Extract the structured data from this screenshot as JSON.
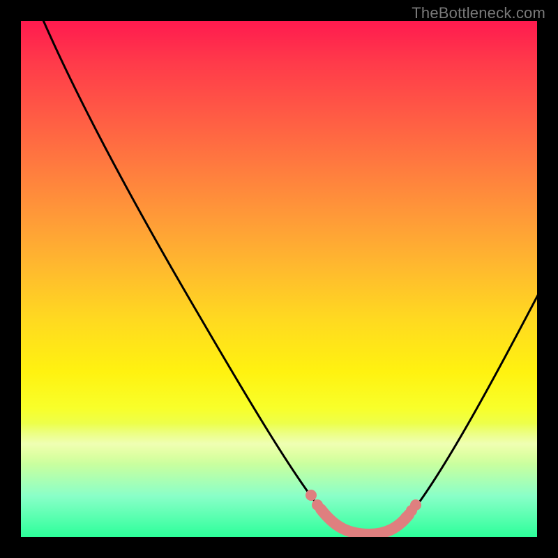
{
  "watermark": {
    "text": "TheBottleneck.com"
  },
  "chart_data": {
    "type": "line",
    "title": "",
    "xlabel": "",
    "ylabel": "",
    "xlim": [
      0,
      100
    ],
    "ylim": [
      0,
      100
    ],
    "grid": false,
    "legend": false,
    "background": {
      "kind": "vertical-gradient",
      "stops": [
        {
          "pct": 0,
          "color": "#ff1a4f"
        },
        {
          "pct": 50,
          "color": "#ffda20"
        },
        {
          "pct": 80,
          "color": "#f8ff60"
        },
        {
          "pct": 100,
          "color": "#2cff9a"
        }
      ]
    },
    "series": [
      {
        "name": "bottleneck-curve",
        "color": "#000000",
        "x": [
          5,
          12,
          22,
          32,
          42,
          52,
          58,
          62,
          66,
          70,
          74,
          80,
          88,
          100
        ],
        "y": [
          100,
          88,
          72,
          56,
          40,
          22,
          10,
          4,
          1,
          0,
          2,
          8,
          22,
          48
        ]
      }
    ],
    "highlight": {
      "name": "optimal-range-marker",
      "color": "#e08080",
      "x": [
        58,
        60,
        62,
        64,
        66,
        68,
        70,
        72,
        73.5,
        74.5
      ],
      "y": [
        9,
        5,
        2.5,
        1.2,
        0.6,
        0.4,
        0.6,
        1.5,
        3,
        5
      ]
    }
  }
}
